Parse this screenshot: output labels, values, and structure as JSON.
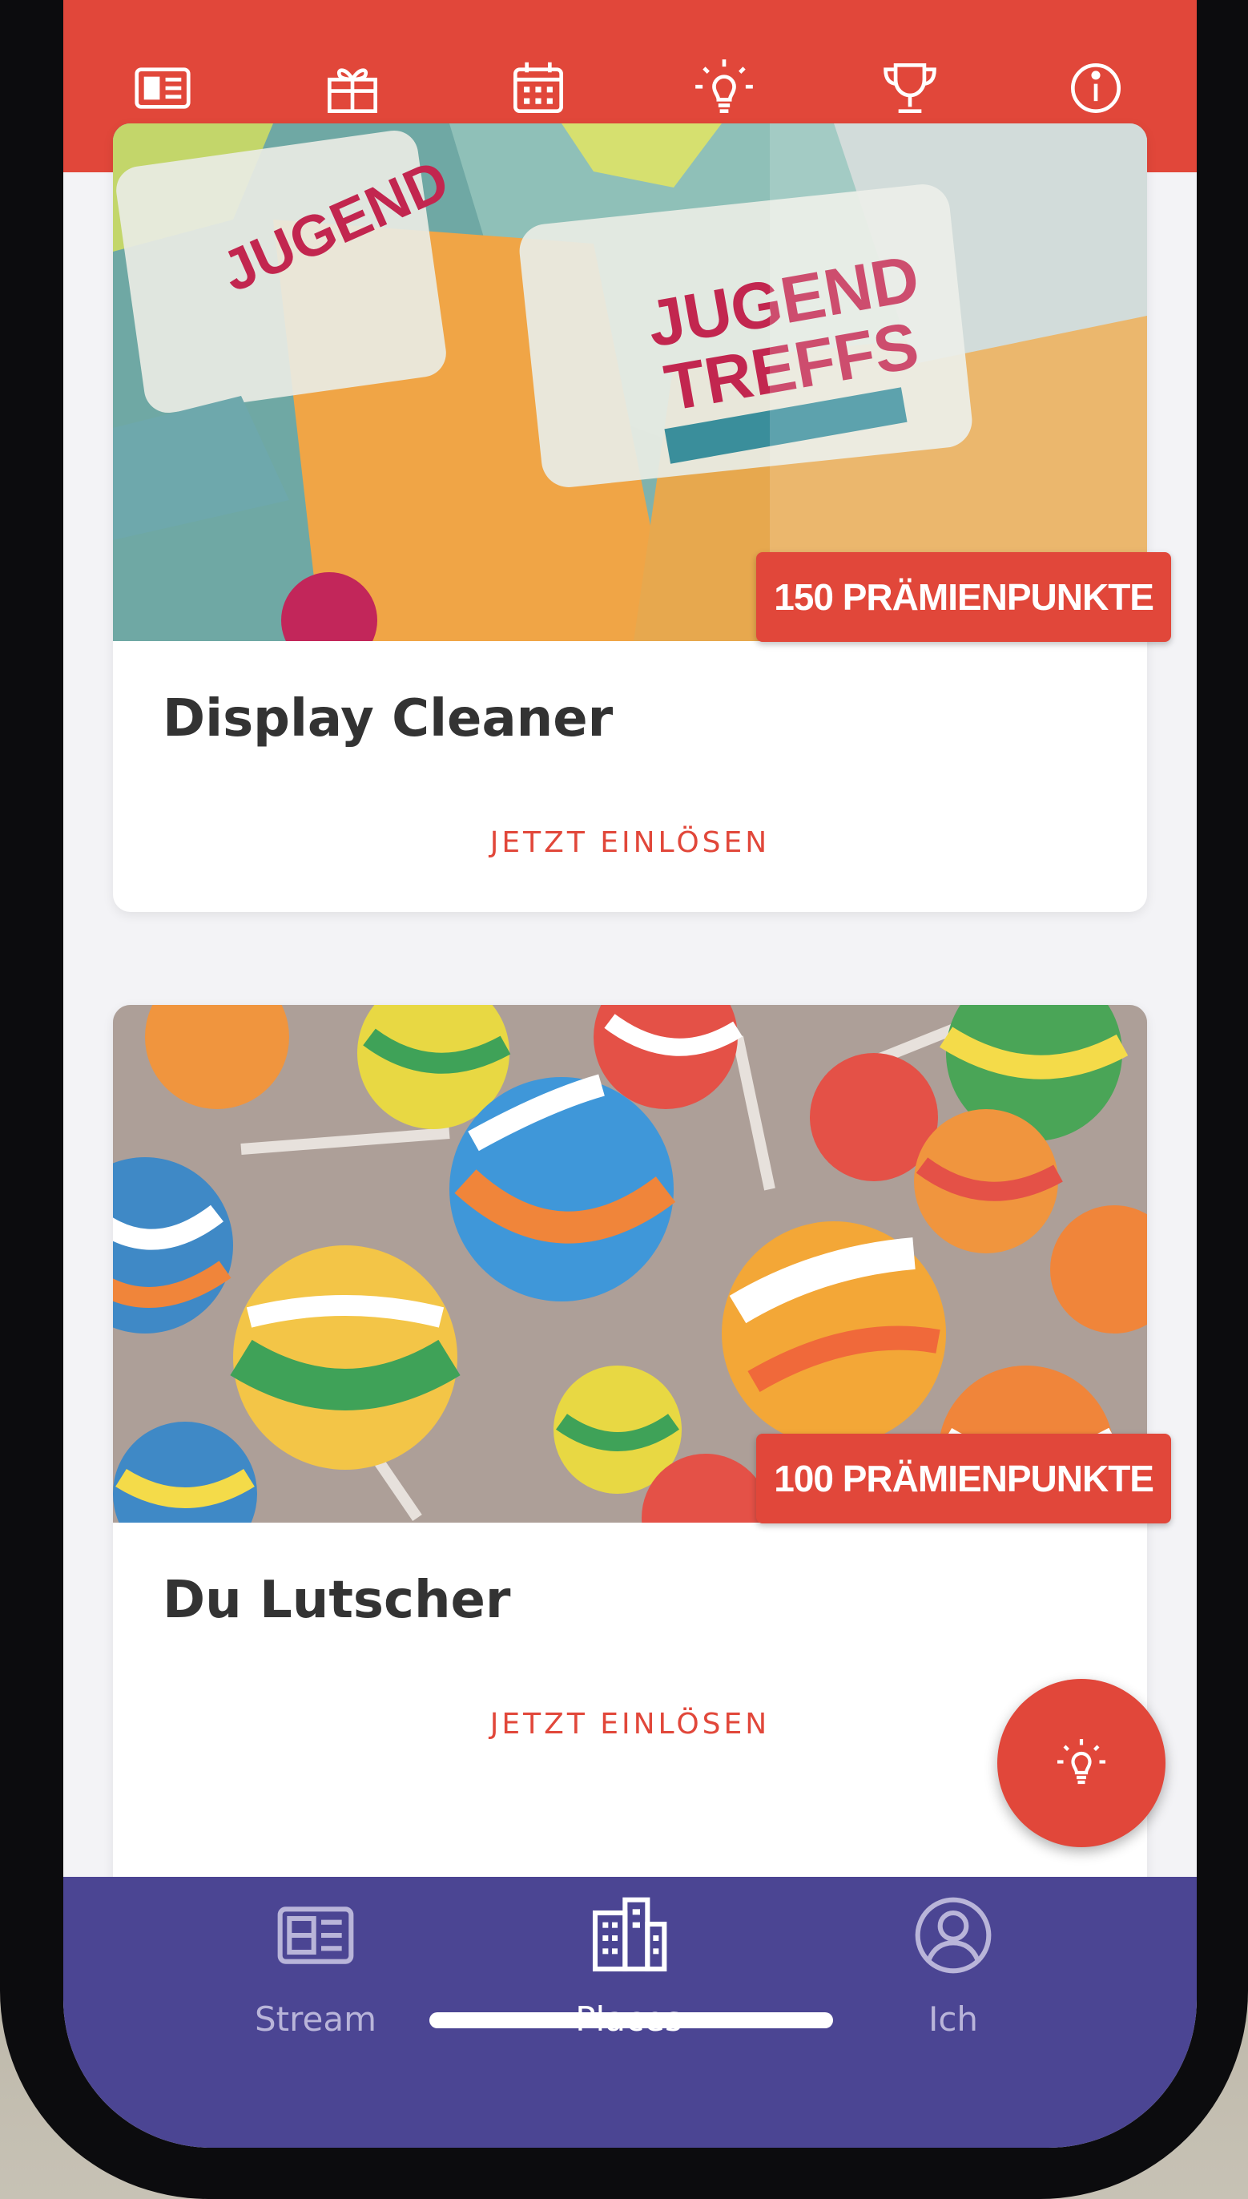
{
  "top_tabs": [
    {
      "icon": "newspaper-icon"
    },
    {
      "icon": "gift-icon",
      "selected": true
    },
    {
      "icon": "calendar-icon"
    },
    {
      "icon": "lightbulb-icon"
    },
    {
      "icon": "trophy-icon"
    },
    {
      "icon": "info-icon"
    }
  ],
  "rewards": [
    {
      "title": "Display Cleaner",
      "points_label": "150 PRÄMIENPUNKTE",
      "action_label": "JETZT EINLÖSEN",
      "image": "sticker-cleaners-photo"
    },
    {
      "title": "Du Lutscher",
      "points_label": "100 PRÄMIENPUNKTE",
      "action_label": "JETZT EINLÖSEN",
      "image": "lollipops-photo"
    }
  ],
  "fab": {
    "icon": "lightbulb-icon"
  },
  "bottom_nav": [
    {
      "label": "Stream",
      "icon": "newspaper-icon"
    },
    {
      "label": "Places",
      "icon": "buildings-icon",
      "active": true
    },
    {
      "label": "Ich",
      "icon": "user-circle-icon"
    }
  ],
  "colors": {
    "primary_red": "#e1473a",
    "nav_purple": "#4b4593",
    "background": "#f3f3f6",
    "title_text": "#333333"
  }
}
